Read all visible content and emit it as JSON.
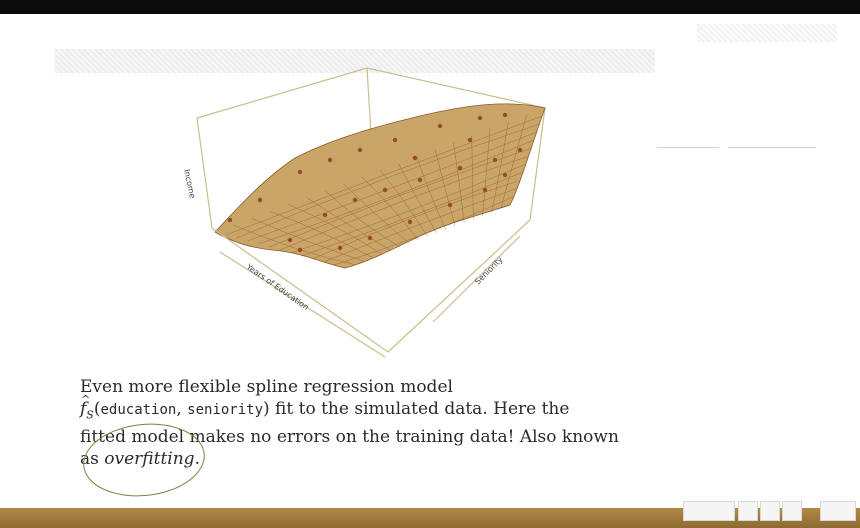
{
  "figure": {
    "z_axis_label": "Income",
    "x_axis_label": "Years of Education",
    "y_axis_label": "Seniority"
  },
  "caption": {
    "line1": "Even more flexible spline regression model",
    "fhat_symbol": "f",
    "fhat_subscript": "S",
    "arg_open": "(",
    "arg1": "education",
    "arg_sep": ", ",
    "arg2": "seniority",
    "arg_close": ")",
    "line2_rest": " fit to the simulated data. Here the",
    "line3": "fitted model makes no errors on the training data! Also known",
    "line4_prefix": "as ",
    "line4_em": "overfitting",
    "line4_suffix": "."
  },
  "colors": {
    "surface": "#c9a567",
    "mesh": "#8a5a2a",
    "box": "#c8bf8c",
    "bottom_bar": "#a37c3c",
    "top_bar": "#0b0b0b"
  }
}
